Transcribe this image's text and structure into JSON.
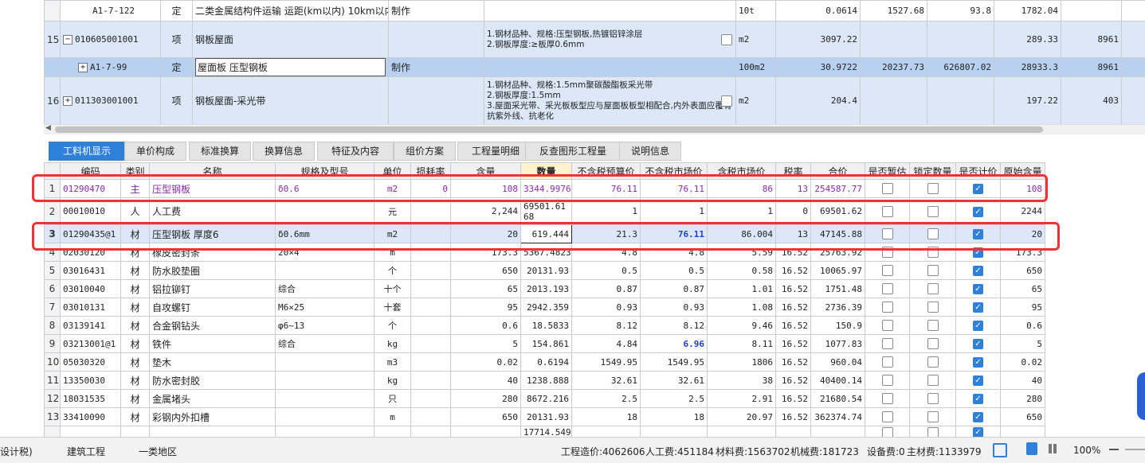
{
  "top_table": {
    "rows": [
      {
        "num": "",
        "code": "A1-7-122",
        "type": "定",
        "name": "二类金属结构件运输 运距(km以内) 10km以内",
        "feature": "制作",
        "desc": "",
        "unit": "10t",
        "qty": "0.0614",
        "c1": "1527.68",
        "c2": "93.8",
        "c3": "1782.04",
        "c4": ""
      },
      {
        "num": "15",
        "code": "010605001001",
        "type": "项",
        "name": "钢板屋面",
        "feature": "",
        "desc": "1.钢材品种、规格:压型钢板,热镀铝锌涂层\n2.钢板厚度:≥板厚0.6mm",
        "unit": "m2",
        "qty": "3097.22",
        "c1": "",
        "c2": "",
        "c3": "289.33",
        "c4": "8961"
      },
      {
        "num": "",
        "code": "A1-7-99",
        "type": "定",
        "name": "屋面板 压型钢板",
        "feature": "制作",
        "desc": "",
        "unit": "100m2",
        "qty": "30.9722",
        "c1": "20237.73",
        "c2": "626807.02",
        "c3": "28933.3",
        "c4": "8961"
      },
      {
        "num": "16",
        "code": "011303001001",
        "type": "项",
        "name": "钢板屋面-采光带",
        "feature": "",
        "desc": "1.钢材品种、规格:1.5mm聚碳酸酯板采光带\n2.钢板厚度:1.5mm\n3.屋面采光带、采光板板型应与屋面板板型相配合,内外表面应覆有抗紫外线、抗老化",
        "unit": "m2",
        "qty": "204.4",
        "c1": "",
        "c2": "",
        "c3": "197.22",
        "c4": "403"
      }
    ]
  },
  "tabs": [
    "工料机显示",
    "单价构成",
    "标准换算",
    "换算信息",
    "特征及内容",
    "组价方案",
    "工程量明细",
    "反查图形工程量",
    "说明信息"
  ],
  "columns": [
    "编码",
    "类别",
    "名称",
    "规格及型号",
    "单位",
    "损耗率",
    "含量",
    "数量",
    "不含税预算价",
    "不含税市场价",
    "含税市场价",
    "税率",
    "合价",
    "是否暂估",
    "锁定数量",
    "是否计价",
    "原始含量"
  ],
  "rows": [
    {
      "n": "1",
      "code": "01290470",
      "cat": "主",
      "name": "压型钢板",
      "spec": "δ0.6",
      "unit": "m2",
      "loss": "0",
      "content": "108",
      "qty": "3344.9976",
      "budget": "76.11",
      "market": "76.11",
      "tax_market": "86",
      "tax": "13",
      "total": "254587.77",
      "est": false,
      "lock": false,
      "priced": true,
      "orig": "108"
    },
    {
      "n": "2",
      "code": "00010010",
      "cat": "人",
      "name": "人工费",
      "spec": "",
      "unit": "元",
      "loss": "",
      "content": "2,244",
      "qty": "69501.6168",
      "budget": "1",
      "market": "1",
      "tax_market": "1",
      "tax": "0",
      "total": "69501.62",
      "est": false,
      "lock": false,
      "priced": true,
      "orig": "2244"
    },
    {
      "n": "3",
      "code": "01290435@1",
      "cat": "材",
      "name": "压型钢板 厚度6",
      "spec": "δ0.6mm",
      "unit": "m2",
      "loss": "",
      "content": "20",
      "qty": "619.444",
      "budget": "21.3",
      "market": "76.11",
      "tax_market": "86.004",
      "tax": "13",
      "total": "47145.88",
      "est": false,
      "lock": false,
      "priced": true,
      "orig": "20"
    },
    {
      "n": "4",
      "code": "02030120",
      "cat": "材",
      "name": "橡皮密封条",
      "spec": "20×4",
      "unit": "m",
      "loss": "",
      "content": "173.3",
      "qty": "5367.4823",
      "budget": "4.8",
      "market": "4.8",
      "tax_market": "5.59",
      "tax": "16.52",
      "total": "25763.92",
      "est": false,
      "lock": false,
      "priced": true,
      "orig": "173.3"
    },
    {
      "n": "5",
      "code": "03016431",
      "cat": "材",
      "name": "防水胶垫圈",
      "spec": "",
      "unit": "个",
      "loss": "",
      "content": "650",
      "qty": "20131.93",
      "budget": "0.5",
      "market": "0.5",
      "tax_market": "0.58",
      "tax": "16.52",
      "total": "10065.97",
      "est": false,
      "lock": false,
      "priced": true,
      "orig": "650"
    },
    {
      "n": "6",
      "code": "03010040",
      "cat": "材",
      "name": "铝拉铆钉",
      "spec": "综合",
      "unit": "十个",
      "loss": "",
      "content": "65",
      "qty": "2013.193",
      "budget": "0.87",
      "market": "0.87",
      "tax_market": "1.01",
      "tax": "16.52",
      "total": "1751.48",
      "est": false,
      "lock": false,
      "priced": true,
      "orig": "65"
    },
    {
      "n": "7",
      "code": "03010131",
      "cat": "材",
      "name": "自攻螺钉",
      "spec": "M6×25",
      "unit": "十套",
      "loss": "",
      "content": "95",
      "qty": "2942.359",
      "budget": "0.93",
      "market": "0.93",
      "tax_market": "1.08",
      "tax": "16.52",
      "total": "2736.39",
      "est": false,
      "lock": false,
      "priced": true,
      "orig": "95"
    },
    {
      "n": "8",
      "code": "03139141",
      "cat": "材",
      "name": "合金钢钻头",
      "spec": "φ6~13",
      "unit": "个",
      "loss": "",
      "content": "0.6",
      "qty": "18.5833",
      "budget": "8.12",
      "market": "8.12",
      "tax_market": "9.46",
      "tax": "16.52",
      "total": "150.9",
      "est": false,
      "lock": false,
      "priced": true,
      "orig": "0.6"
    },
    {
      "n": "9",
      "code": "03213001@1",
      "cat": "材",
      "name": "铁件",
      "spec": "综合",
      "unit": "kg",
      "loss": "",
      "content": "5",
      "qty": "154.861",
      "budget": "4.84",
      "market": "6.96",
      "tax_market": "8.11",
      "tax": "16.52",
      "total": "1077.83",
      "est": false,
      "lock": false,
      "priced": true,
      "orig": "5"
    },
    {
      "n": "10",
      "code": "05030320",
      "cat": "材",
      "name": "垫木",
      "spec": "",
      "unit": "m3",
      "loss": "",
      "content": "0.02",
      "qty": "0.6194",
      "budget": "1549.95",
      "market": "1549.95",
      "tax_market": "1806",
      "tax": "16.52",
      "total": "960.04",
      "est": false,
      "lock": false,
      "priced": true,
      "orig": "0.02"
    },
    {
      "n": "11",
      "code": "13350030",
      "cat": "材",
      "name": "防水密封胶",
      "spec": "",
      "unit": "kg",
      "loss": "",
      "content": "40",
      "qty": "1238.888",
      "budget": "32.61",
      "market": "32.61",
      "tax_market": "38",
      "tax": "16.52",
      "total": "40400.14",
      "est": false,
      "lock": false,
      "priced": true,
      "orig": "40"
    },
    {
      "n": "12",
      "code": "18031535",
      "cat": "材",
      "name": "金属堵头",
      "spec": "",
      "unit": "只",
      "loss": "",
      "content": "280",
      "qty": "8672.216",
      "budget": "2.5",
      "market": "2.5",
      "tax_market": "2.91",
      "tax": "16.52",
      "total": "21680.54",
      "est": false,
      "lock": false,
      "priced": true,
      "orig": "280"
    },
    {
      "n": "13",
      "code": "33410090",
      "cat": "材",
      "name": "彩钢内外扣槽",
      "spec": "",
      "unit": "m",
      "loss": "",
      "content": "650",
      "qty": "20131.93",
      "budget": "18",
      "market": "18",
      "tax_market": "20.97",
      "tax": "16.52",
      "total": "362374.74",
      "est": false,
      "lock": false,
      "priced": true,
      "orig": "650"
    },
    {
      "n": "",
      "code": "",
      "cat": "",
      "name": "",
      "spec": "",
      "unit": "",
      "loss": "",
      "content": "",
      "qty": "17714.549",
      "budget": "",
      "market": "",
      "tax_market": "",
      "tax": "",
      "total": "",
      "est": false,
      "lock": false,
      "priced": true,
      "orig": ""
    }
  ],
  "status": {
    "left1": "设计税)",
    "left2": "建筑工程",
    "left3": "一类地区",
    "cost": "工程造价:4062606",
    "labor": "人工费:451184",
    "material": "材料费:1563702",
    "machine": "机械费:181723",
    "equipment": "设备费:0",
    "main_material": "主材费:1133979",
    "zoom": "100%"
  },
  "colors": {
    "accent": "#2f80d8",
    "highlight_border": "#e33333",
    "purple_text": "#8a2aa9",
    "blue_bold": "#1b3fd1"
  }
}
